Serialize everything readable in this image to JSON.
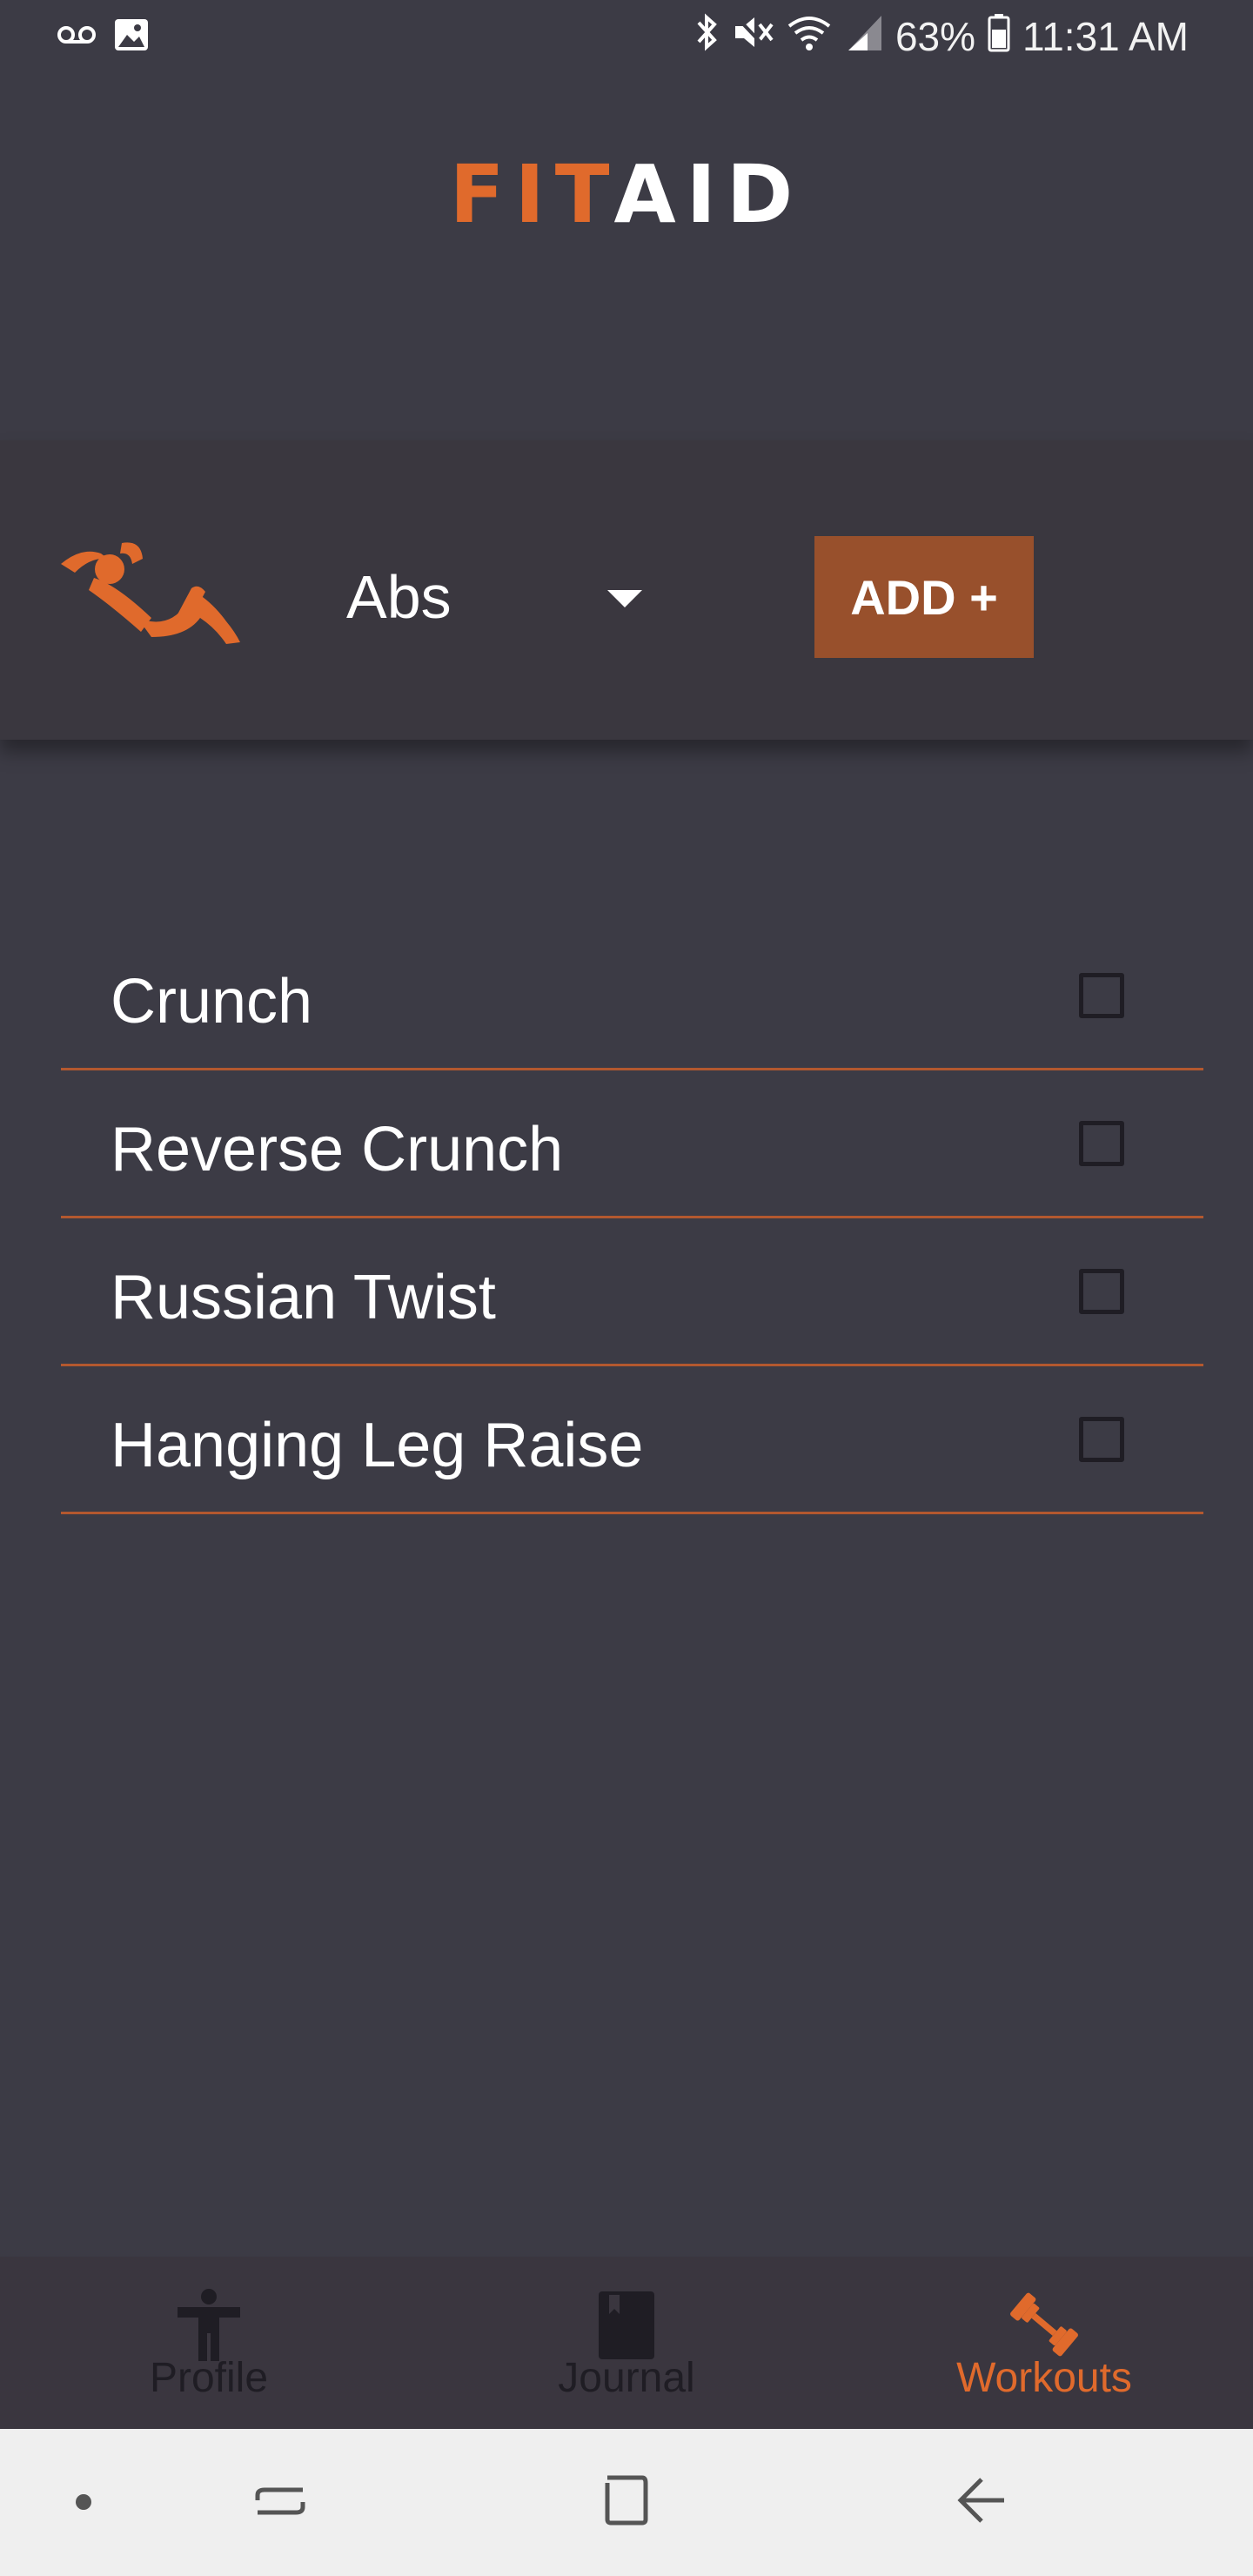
{
  "status_bar": {
    "battery_percent": "63%",
    "time": "11:31 AM",
    "icons": [
      "voicemail-icon",
      "image-icon",
      "bluetooth-icon",
      "mute-icon",
      "wifi-icon",
      "signal-icon",
      "battery-icon"
    ]
  },
  "app": {
    "logo_part1": "FIT",
    "logo_part2": "AID"
  },
  "category": {
    "selected": "Abs",
    "add_label": "ADD +",
    "icon": "ab-crunch-figure-icon"
  },
  "exercises": [
    {
      "name": "Crunch",
      "checked": false
    },
    {
      "name": "Reverse Crunch",
      "checked": false
    },
    {
      "name": "Russian Twist",
      "checked": false
    },
    {
      "name": "Hanging Leg Raise",
      "checked": false
    }
  ],
  "bottom_nav": {
    "items": [
      {
        "label": "Profile",
        "icon": "person-icon",
        "active": false
      },
      {
        "label": "Journal",
        "icon": "book-icon",
        "active": false
      },
      {
        "label": "Workouts",
        "icon": "dumbbell-icon",
        "active": true
      }
    ]
  },
  "colors": {
    "background": "#3c3b45",
    "accent": "#e06a2c",
    "button": "#98502c",
    "divider": "#b3582f",
    "nav_inactive": "#1f1d24"
  }
}
